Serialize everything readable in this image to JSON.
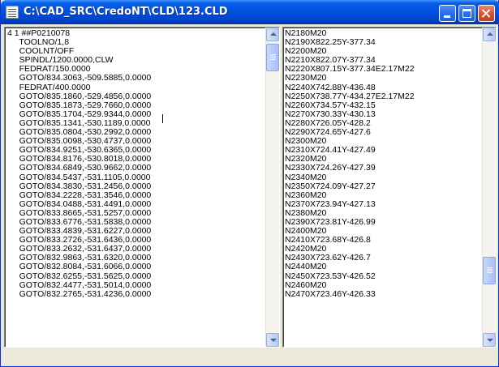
{
  "window": {
    "title": "C:\\CAD_SRC\\CredoNT\\CLD\\123.CLD"
  },
  "colors": {
    "titlebar": "#0054e3",
    "close_button": "#d8552f",
    "pane_background": "#ffffff",
    "window_background": "#ece9d8"
  },
  "left_pane": {
    "lines": [
      "4 1 ##P0210078",
      "     TOOLNO/1,8",
      "     COOLNT/OFF",
      "     SPINDL/1200.0000,CLW",
      "     FEDRAT/150.0000",
      "     GOTO/834.3063,-509.5885,0.0000",
      "     FEDRAT/400.0000",
      "     GOTO/835.1860,-529.4856,0.0000",
      "     GOTO/835.1873,-529.7660,0.0000",
      "     GOTO/835.1704,-529.9344,0.0000",
      "     GOTO/835.1341,-530.1189,0.0000",
      "     GOTO/835.0804,-530.2992,0.0000",
      "     GOTO/835.0098,-530.4737,0.0000",
      "     GOTO/834.9251,-530.6365,0.0000",
      "     GOTO/834.8176,-530.8018,0.0000",
      "     GOTO/834.6849,-530.9662,0.0000",
      "     GOTO/834.5437,-531.1105,0.0000",
      "     GOTO/834.3830,-531.2456,0.0000",
      "     GOTO/834.2228,-531.3546,0.0000",
      "     GOTO/834.0488,-531.4491,0.0000",
      "     GOTO/833.8665,-531.5257,0.0000",
      "     GOTO/833.6776,-531.5838,0.0000",
      "     GOTO/833.4839,-531.6227,0.0000",
      "     GOTO/833.2726,-531.6436,0.0000",
      "     GOTO/833.2632,-531.6437,0.0000",
      "     GOTO/832.9863,-531.6320,0.0000",
      "     GOTO/832.8084,-531.6066,0.0000",
      "     GOTO/832.6255,-531.5625,0.0000",
      "     GOTO/832.4477,-531.5014,0.0000",
      "     GOTO/832.2765,-531.4236,0.0000"
    ]
  },
  "right_pane": {
    "lines": [
      "N2180M20",
      "N2190X822.25Y-377.34",
      "N2200M20",
      "N2210X822.07Y-377.34",
      "N2220X807.15Y-377.34E2.17M22",
      "N2230M20",
      "N2240X742.88Y-436.48",
      "N2250X738.77Y-434.27E2.17M22",
      "N2260X734.57Y-432.15",
      "N2270X730.33Y-430.13",
      "N2280X726.05Y-428.2",
      "N2290X724.65Y-427.6",
      "N2300M20",
      "N2310X724.41Y-427.49",
      "N2320M20",
      "N2330X724.26Y-427.39",
      "N2340M20",
      "N2350X724.09Y-427.27",
      "N2360M20",
      "N2370X723.94Y-427.13",
      "N2380M20",
      "N2390X723.81Y-426.99",
      "N2400M20",
      "N2410X723.68Y-426.8",
      "N2420M20",
      "N2430X723.62Y-426.7",
      "N2440M20",
      "N2450X723.53Y-426.52",
      "N2460M20",
      "N2470X723.46Y-426.33"
    ]
  }
}
